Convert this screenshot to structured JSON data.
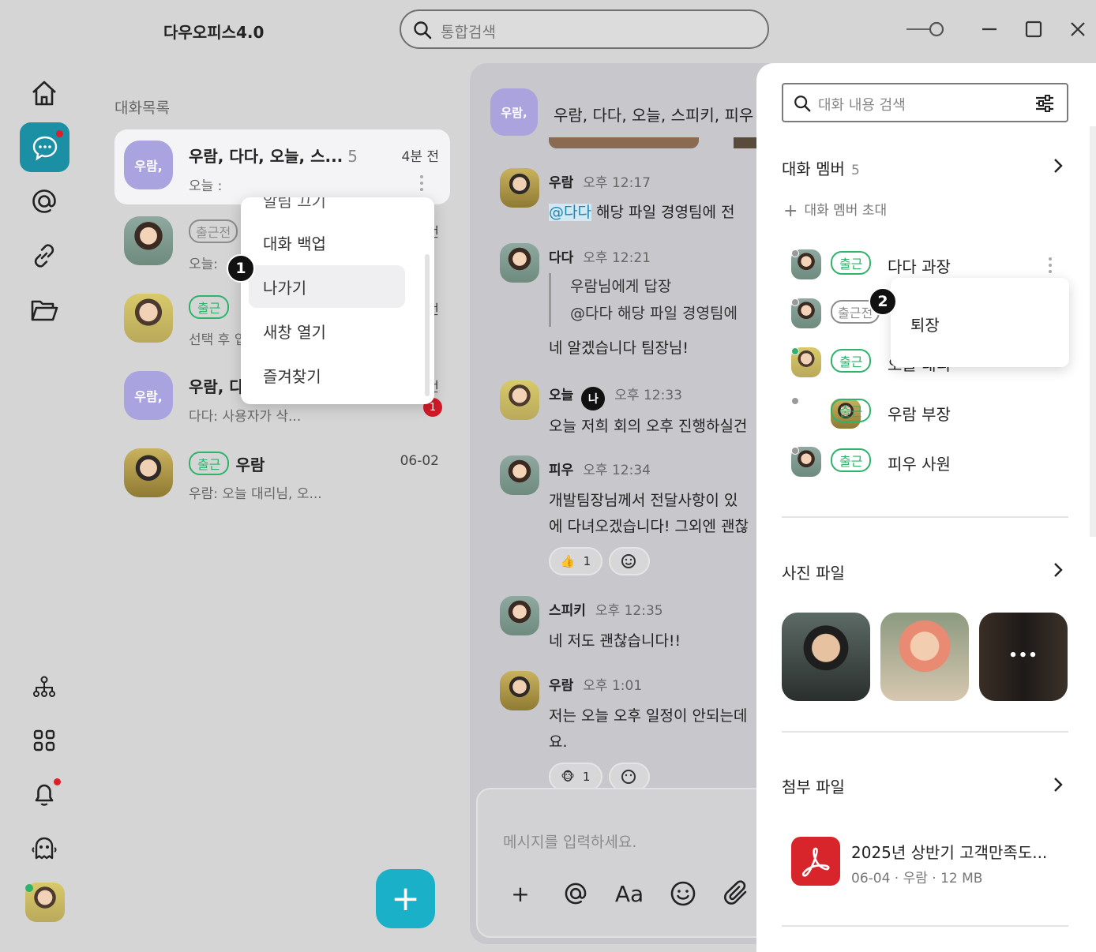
{
  "app": {
    "title": "다우오피스4.0"
  },
  "search": {
    "placeholder": "통합검색"
  },
  "list": {
    "title": "대화목록",
    "items": [
      {
        "avatar": "우람,",
        "name": "우람, 다다, 오늘, 스...",
        "count": "5",
        "time": "4분 전",
        "preview": "오늘 :"
      },
      {
        "badge": "출근전",
        "preview": "오늘:",
        "time": "전"
      },
      {
        "badge": "출근",
        "preview": "선택 후 입",
        "time": "전"
      },
      {
        "avatar": "우람,",
        "name": "우람, 다",
        "preview": "다다: 사용자가 삭...",
        "time": "전",
        "unread": "1"
      },
      {
        "badge": "출근",
        "name": "우람",
        "time": "06-02",
        "preview": "우람: 오늘 대리님, 오..."
      }
    ]
  },
  "menu": {
    "items": [
      "알림 끄기",
      "대화 백업",
      "나가기",
      "새창 열기",
      "즐겨찾기"
    ],
    "step": "1"
  },
  "chat": {
    "avatar": "우람,",
    "title": "우람, 다다, 오늘, 스피키, 피우",
    "messages": [
      {
        "name": "우람",
        "time": "오후 12:17",
        "mention": "@다다",
        "text": " 해당 파일 경영팀에 전"
      },
      {
        "name": "다다",
        "time": "오후 12:21",
        "reply_1": "우람님에게 답장",
        "reply_2": "@다다 해당 파일 경영팀에",
        "text": "네 알겠습니다 팀장님!"
      },
      {
        "name": "오늘",
        "me": "나",
        "time": "오후 12:33",
        "text": "오늘 저희 회의 오후 진행하실건"
      },
      {
        "name": "피우",
        "time": "오후 12:34",
        "text_1": "개발팀장님께서 전달사항이 있",
        "text_2": "에 다녀오겠습니다! 그외엔 괜찮",
        "react_count": "1"
      },
      {
        "name": "스피키",
        "time": "오후 12:35",
        "text": "네 저도 괜찮습니다!!"
      },
      {
        "name": "우람",
        "time": "오후 1:01",
        "text_1": "저는 오늘 오후 일정이 안되는데",
        "text_2": "요.",
        "react_count": "1"
      }
    ],
    "input_placeholder": "메시지를 입력하세요."
  },
  "panel": {
    "search_placeholder": "대화 내용 검색",
    "members_title": "대화 멤버",
    "members_count": "5",
    "invite": "대화 멤버 초대",
    "members": [
      {
        "badge": "출근",
        "name": "다다 과장"
      },
      {
        "badge": "출근전",
        "name": ""
      },
      {
        "badge": "출근",
        "name": "오늘 대리"
      },
      {
        "badge": "출근",
        "name": "우람 부장"
      },
      {
        "badge": "출근",
        "name": "피우 사원"
      }
    ],
    "popup_label": "퇴장",
    "step": "2",
    "photos_title": "사진 파일",
    "photos_more": "•••",
    "files_title": "첨부 파일",
    "file": {
      "name": "2025년 상반기 고객만족도...",
      "meta": "06-04 · 우람 · 12 MB"
    }
  },
  "colors": {
    "accent": "#1b8fa4",
    "fab": "#1ab1c8",
    "online": "#2fb26a",
    "alert": "#d11a28"
  }
}
